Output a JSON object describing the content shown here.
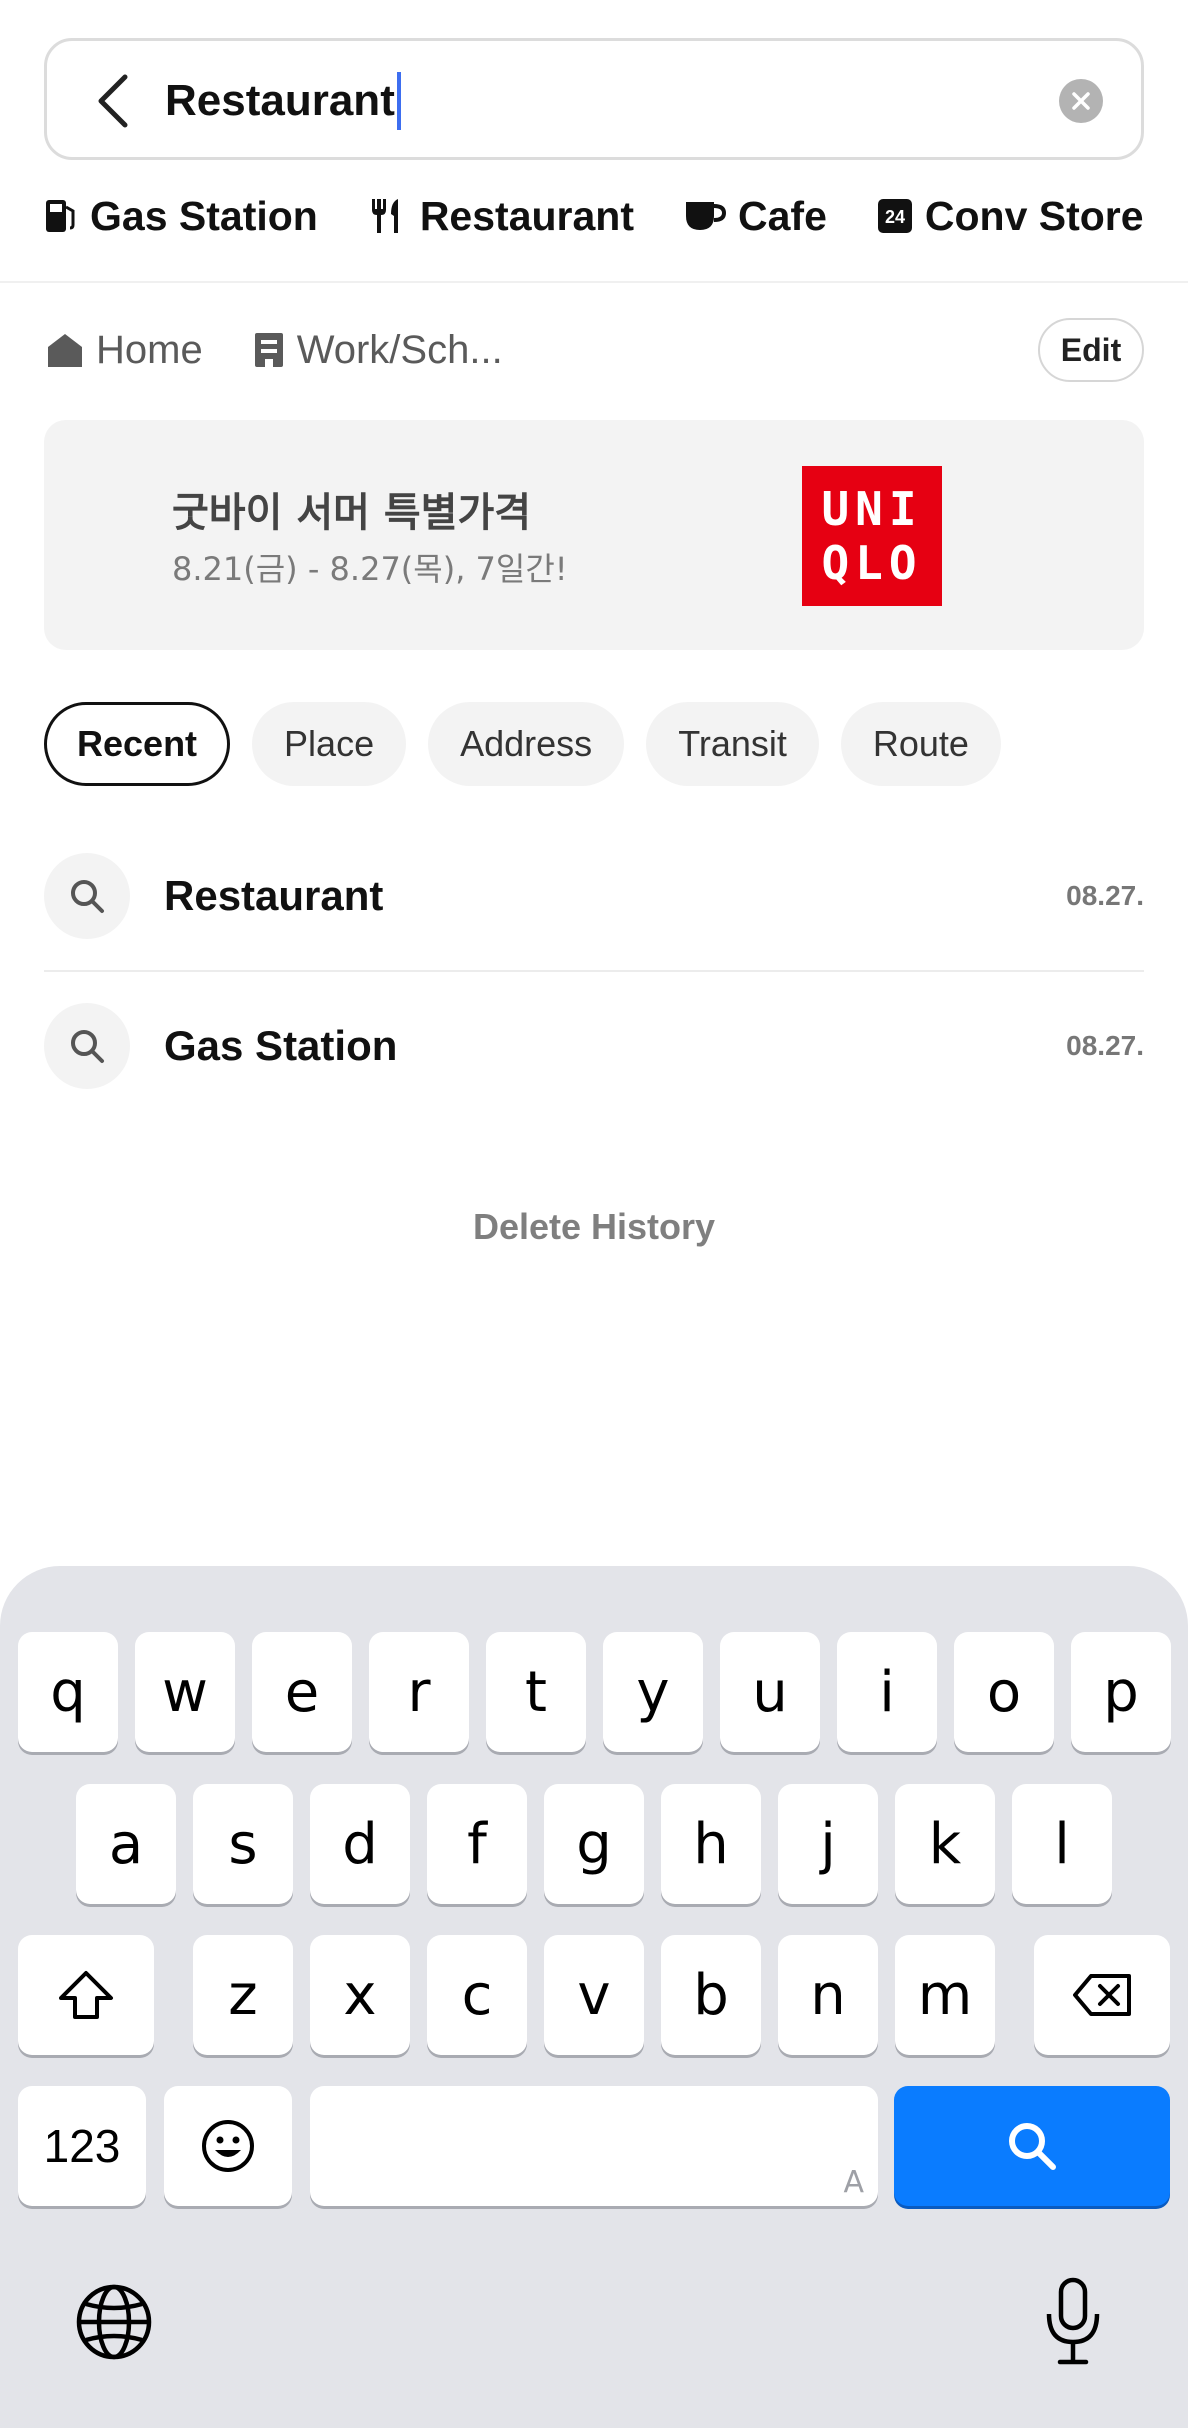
{
  "search": {
    "query": "Restaurant",
    "back_icon": "chevron-left-icon",
    "clear_icon": "clear-icon"
  },
  "categories": [
    {
      "label": "Gas Station",
      "icon": "gas-pump-icon"
    },
    {
      "label": "Restaurant",
      "icon": "fork-knife-icon"
    },
    {
      "label": "Cafe",
      "icon": "coffee-cup-icon"
    },
    {
      "label": "Conv Store",
      "icon": "24-hour-store-icon"
    }
  ],
  "favorites": {
    "items": [
      {
        "label": "Home",
        "icon": "home-icon"
      },
      {
        "label": "Work/Sch...",
        "icon": "building-icon"
      }
    ],
    "edit_label": "Edit"
  },
  "banner": {
    "title": "굿바이 서머 특별가격",
    "subtitle": "8.21(금) - 8.27(목), 7일간!",
    "logo_line1": "UNI",
    "logo_line2": "QLO",
    "logo_color": "#e60012"
  },
  "tabs": [
    {
      "label": "Recent",
      "active": true
    },
    {
      "label": "Place",
      "active": false
    },
    {
      "label": "Address",
      "active": false
    },
    {
      "label": "Transit",
      "active": false
    },
    {
      "label": "Route",
      "active": false
    }
  ],
  "history": [
    {
      "label": "Restaurant",
      "date": "08.27."
    },
    {
      "label": "Gas Station",
      "date": "08.27."
    }
  ],
  "delete_history_label": "Delete History",
  "keyboard": {
    "row1": [
      "q",
      "w",
      "e",
      "r",
      "t",
      "y",
      "u",
      "i",
      "o",
      "p"
    ],
    "row2": [
      "a",
      "s",
      "d",
      "f",
      "g",
      "h",
      "j",
      "k",
      "l"
    ],
    "row3": [
      "z",
      "x",
      "c",
      "v",
      "b",
      "n",
      "m"
    ],
    "numbers_label": "123",
    "space_hint": "A",
    "search_color": "#0a7cff"
  }
}
